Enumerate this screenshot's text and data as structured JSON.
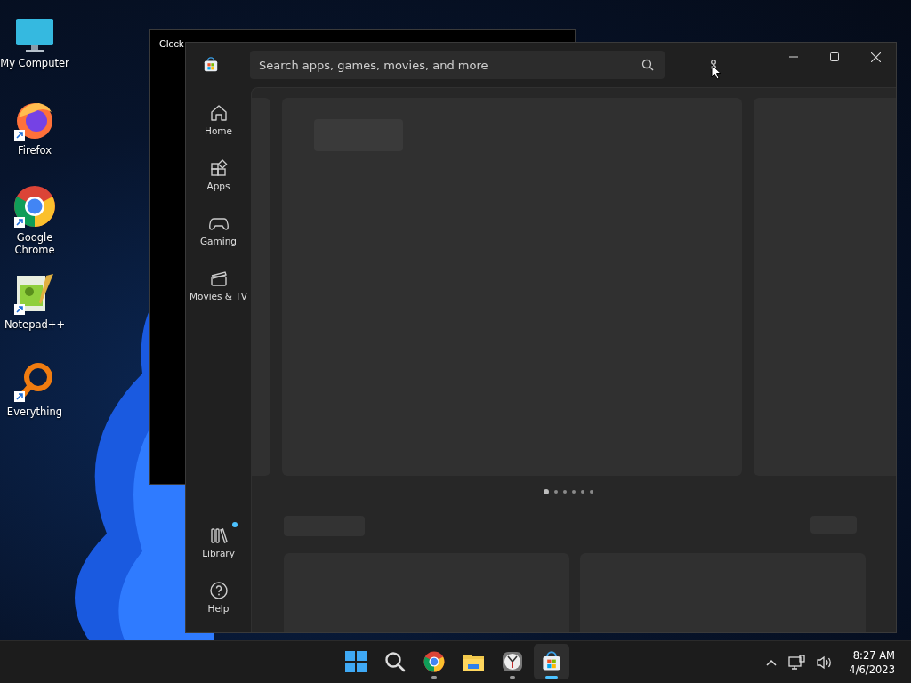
{
  "desktop_icons": [
    {
      "label": "My Computer",
      "kind": "computer",
      "shortcut": false
    },
    {
      "label": "Firefox",
      "kind": "firefox",
      "shortcut": true
    },
    {
      "label": "Google Chrome",
      "kind": "chrome",
      "shortcut": true
    },
    {
      "label": "Notepad++",
      "kind": "notepad",
      "shortcut": true
    },
    {
      "label": "Everything",
      "kind": "everything",
      "shortcut": true
    }
  ],
  "clock_window": {
    "title": "Clock"
  },
  "store_window": {
    "search": {
      "placeholder": "Search apps, games, movies, and more"
    },
    "nav_items": [
      {
        "label": "Home",
        "kind": "home",
        "notification": false
      },
      {
        "label": "Apps",
        "kind": "apps",
        "notification": false
      },
      {
        "label": "Gaming",
        "kind": "gaming",
        "notification": false
      },
      {
        "label": "Movies & TV",
        "kind": "movies",
        "notification": false
      }
    ],
    "bottom_nav_items": [
      {
        "label": "Library",
        "kind": "library",
        "notification": true
      },
      {
        "label": "Help",
        "kind": "help",
        "notification": false
      }
    ],
    "carousel_dots": [
      {
        "selected": true
      },
      {
        "selected": false
      },
      {
        "selected": false
      },
      {
        "selected": false
      },
      {
        "selected": false
      },
      {
        "selected": false
      }
    ]
  },
  "taskbar": {
    "apps": [
      {
        "kind": "start",
        "running": false,
        "selected": false
      },
      {
        "kind": "search",
        "running": false,
        "selected": false
      },
      {
        "kind": "chrome",
        "running": true,
        "selected": false
      },
      {
        "kind": "explorer",
        "running": false,
        "selected": false
      },
      {
        "kind": "clock",
        "running": true,
        "selected": false
      },
      {
        "kind": "store",
        "running": true,
        "selected": true
      }
    ],
    "time": "8:27 AM",
    "date": "4/6/2023"
  }
}
